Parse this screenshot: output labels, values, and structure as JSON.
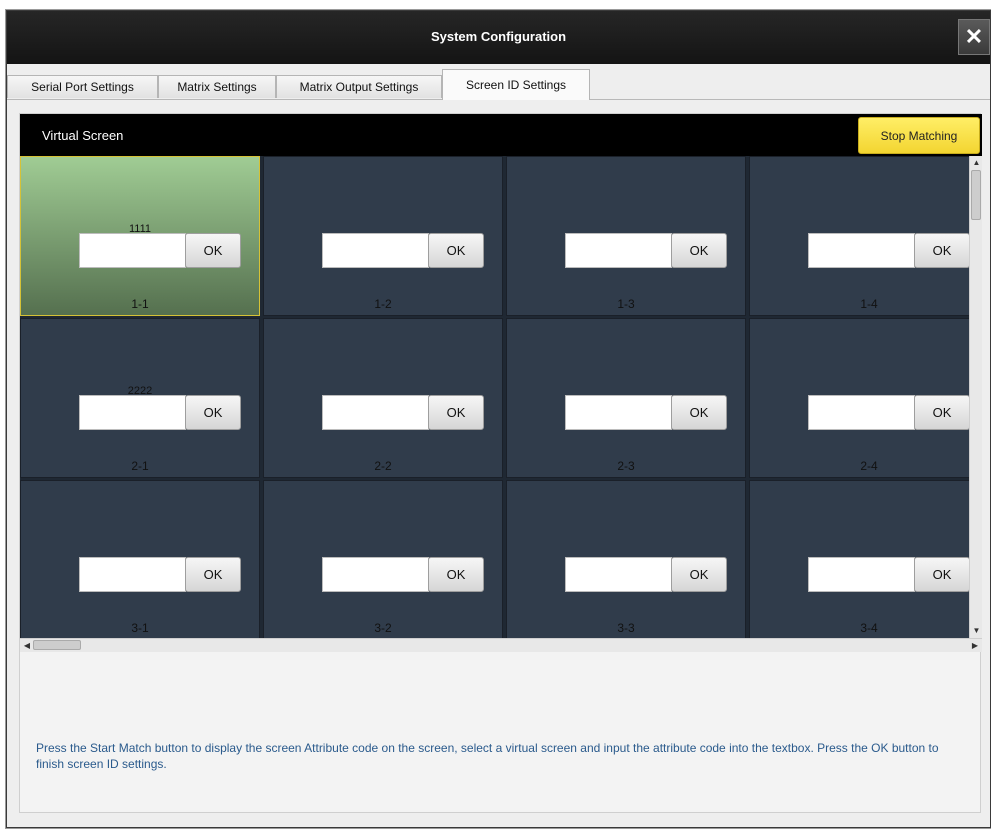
{
  "window": {
    "title": "System Configuration",
    "close_glyph": "✕"
  },
  "tabs": [
    {
      "label": "Serial Port Settings",
      "active": false
    },
    {
      "label": "Matrix Settings",
      "active": false
    },
    {
      "label": "Matrix Output Settings",
      "active": false
    },
    {
      "label": "Screen ID Settings",
      "active": true
    }
  ],
  "virtual_screen": {
    "title": "Virtual Screen",
    "stop_button_label": "Stop Matching",
    "ok_label": "OK",
    "cells": [
      {
        "label": "1-1",
        "code": "1111",
        "selected": true
      },
      {
        "label": "1-2",
        "code": "",
        "selected": false
      },
      {
        "label": "1-3",
        "code": "",
        "selected": false
      },
      {
        "label": "1-4",
        "code": "",
        "selected": false
      },
      {
        "label": "2-1",
        "code": "2222",
        "selected": false
      },
      {
        "label": "2-2",
        "code": "",
        "selected": false
      },
      {
        "label": "2-3",
        "code": "",
        "selected": false
      },
      {
        "label": "2-4",
        "code": "",
        "selected": false
      },
      {
        "label": "3-1",
        "code": "",
        "selected": false
      },
      {
        "label": "3-2",
        "code": "",
        "selected": false
      },
      {
        "label": "3-3",
        "code": "",
        "selected": false
      },
      {
        "label": "3-4",
        "code": "",
        "selected": false
      }
    ]
  },
  "instructions": "Press the Start Match button to display the screen Attribute code on the screen, select a virtual screen and input the attribute code into the textbox. Press the OK button to finish screen ID settings.",
  "colors": {
    "selected_cell_top": "#a0cc94",
    "selected_cell_bottom": "#55704f",
    "cell_bg": "#303c4b",
    "stop_button": "#f3d531",
    "instruction_text": "#2a5a8c"
  }
}
